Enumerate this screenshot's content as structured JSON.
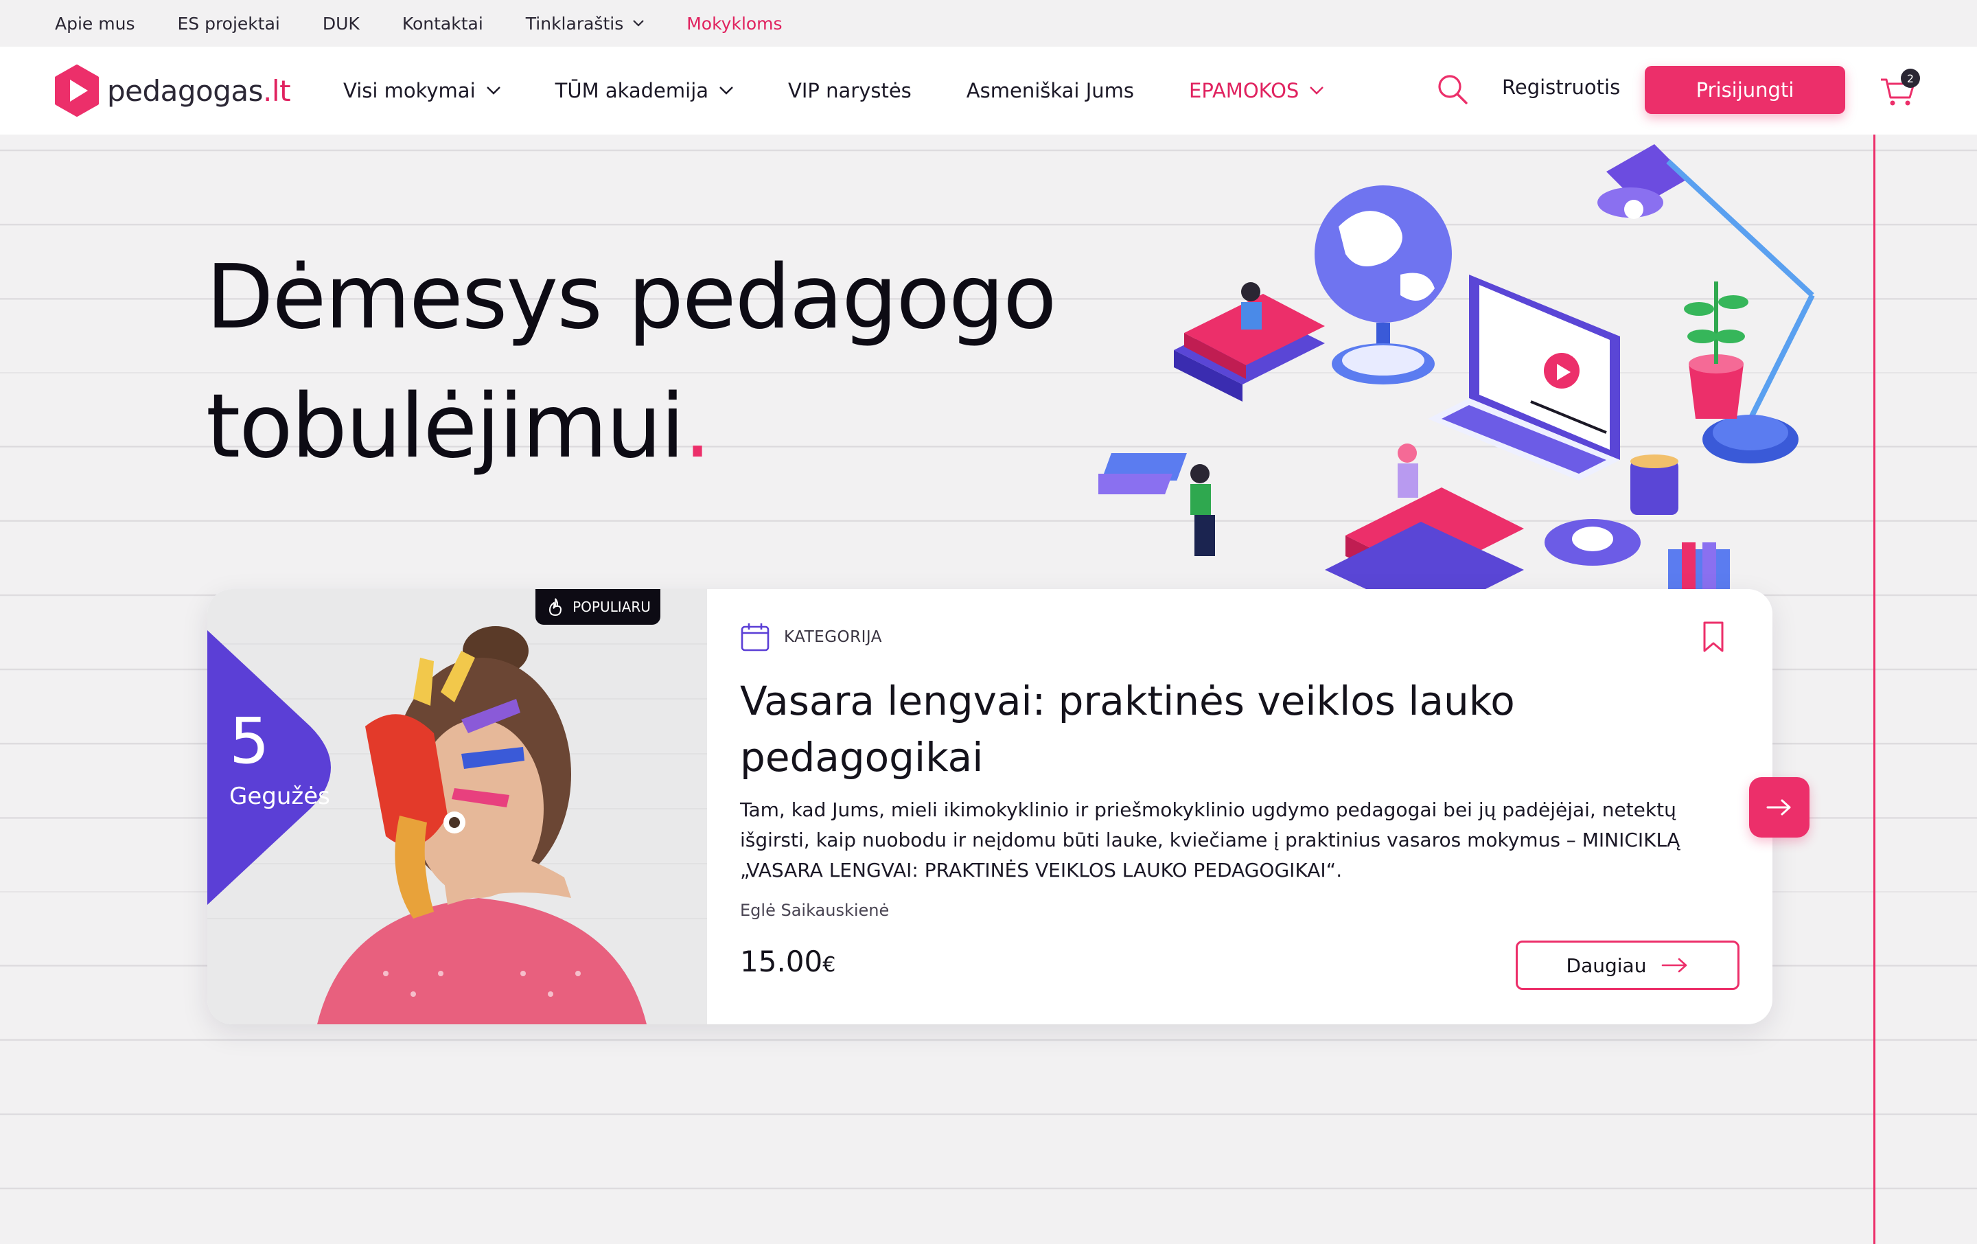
{
  "utility_nav": {
    "about": "Apie mus",
    "es_projects": "ES projektai",
    "faq": "DUK",
    "contacts": "Kontaktai",
    "blog": "Tinklaraštis",
    "schools": "Mokykloms"
  },
  "header": {
    "logo_text": "pedagogas",
    "logo_tld": ".lt",
    "nav": {
      "all_courses": "Visi mokymai",
      "tum_academy": "TŪM akademija",
      "vip": "VIP narystės",
      "personal": "Asmeniškai Jums",
      "elessons": "EPAMOKOS"
    },
    "register": "Registruotis",
    "login": "Prisijungti",
    "cart_count": "2"
  },
  "hero": {
    "title_line1": "Dėmesys pedagogo",
    "title_line2": "tobulėjimui",
    "title_dot": "."
  },
  "event_card": {
    "popular_label": "POPULIARU",
    "date_day": "5",
    "date_month": "Gegužės",
    "category": "KATEGORIJA",
    "title": "Vasara lengvai: praktinės veiklos lauko pedagogikai",
    "description": "Tam, kad Jums, mieli ikimokyklinio ir priešmokyklinio ugdymo pedagogai bei jų padėjėjai, netektų išgirsti, kaip nuobodu ir neįdomu būti lauke, kviečiame į praktinius vasaros mokymus – MINICIKLĄ „VASARA LENGVAI: PRAKTINĖS VEIKLOS LAUKO PEDAGOGIKAI“.",
    "author": "Eglė Saikauskienė",
    "price": "15.00",
    "currency": "€",
    "more_label": "Daugiau"
  },
  "colors": {
    "accent": "#ec2f6a",
    "purple": "#5b3fd6",
    "background": "#f2f1f2"
  }
}
